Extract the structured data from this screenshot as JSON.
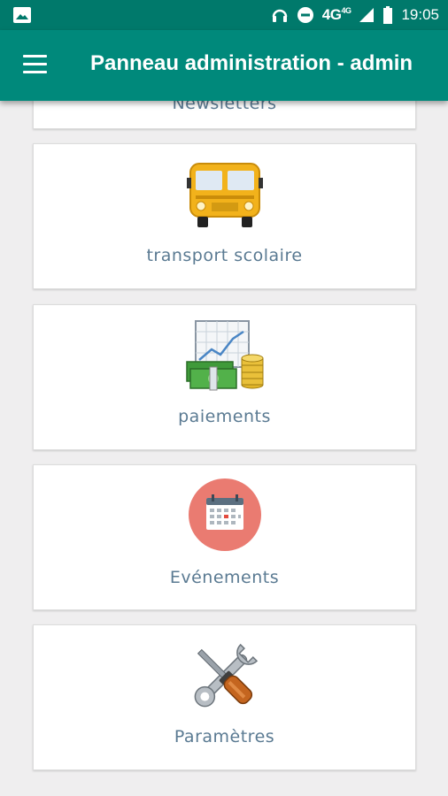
{
  "status_bar": {
    "network": "4G",
    "network_sup": "4G",
    "time": "19:05",
    "icons": [
      "image-icon",
      "headphones-icon",
      "do-not-disturb-icon",
      "signal-icon",
      "battery-icon"
    ]
  },
  "app_bar": {
    "menu_icon": "hamburger-menu-icon",
    "title": "Panneau administration - admin"
  },
  "cards": [
    {
      "label": "Newsletters",
      "icon": "newsletter-icon"
    },
    {
      "label": "transport scolaire",
      "icon": "school-bus-icon"
    },
    {
      "label": "paiements",
      "icon": "payments-chart-money-icon"
    },
    {
      "label": "Evénements",
      "icon": "calendar-icon"
    },
    {
      "label": "Paramètres",
      "icon": "tools-icon"
    }
  ],
  "colors": {
    "status_bar": "#00796b",
    "app_bar": "#00897b",
    "background": "#efeeef",
    "label": "#5a7a92"
  }
}
